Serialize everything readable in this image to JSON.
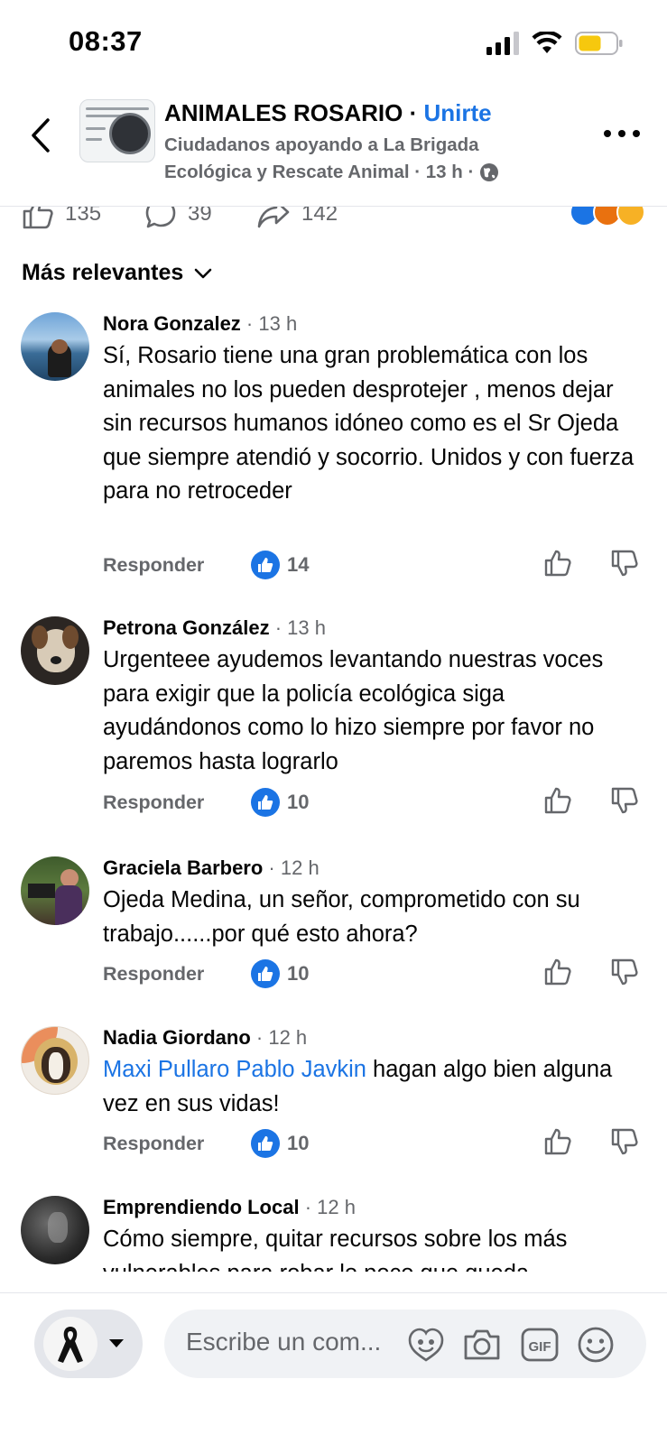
{
  "status_bar": {
    "time": "08:37"
  },
  "header": {
    "group_name": "ANIMALES ROSARIO",
    "separator": " · ",
    "join_label": "Unirte",
    "post_author_line1": "Ciudadanos apoyando a La Brigada",
    "post_author_line2": "Ecológica y Rescate Animal",
    "post_time": " · 13 h · "
  },
  "reactions_bar": {
    "likes": "135",
    "comments": "39",
    "shares": "142"
  },
  "sort": {
    "label": "Más relevantes"
  },
  "comments": [
    {
      "author": "Nora Gonzalez",
      "time": " · 13 h",
      "text": "Sí, Rosario tiene una gran problemática con los animales no los pueden desprotejer , menos dejar sin recursos humanos idóneo como es el Sr Ojeda que siempre atendió y socorrio. Unidos y con fuerza para no retroceder",
      "reply_label": "Responder",
      "likes": "14"
    },
    {
      "author": "Petrona González",
      "time": " · 13 h",
      "text": "Urgenteee ayudemos levantando nuestras voces para exigir que la policía ecológica siga ayudándonos como lo hizo siempre por favor no paremos hasta lograrlo",
      "reply_label": "Responder",
      "likes": "10"
    },
    {
      "author": "Graciela Barbero",
      "time": " · 12 h",
      "text": "Ojeda Medina, un señor, comprometido con su trabajo......por qué esto ahora?",
      "reply_label": "Responder",
      "likes": "10"
    },
    {
      "author": "Nadia Giordano",
      "time": " · 12 h",
      "mention": "Maxi Pullaro Pablo Javkin",
      "text": " hagan algo bien alguna vez en sus vidas!",
      "reply_label": "Responder",
      "likes": "10"
    },
    {
      "author": "Emprendiendo Local",
      "time": " · 12 h",
      "text": "Cómo siempre, quitar recursos sobre los más vulnerables para robar lo poco que queda"
    }
  ],
  "composer": {
    "placeholder": "Escribe un com..."
  },
  "colors": {
    "accent": "#1b74e4",
    "secondary_text": "#65676b"
  }
}
